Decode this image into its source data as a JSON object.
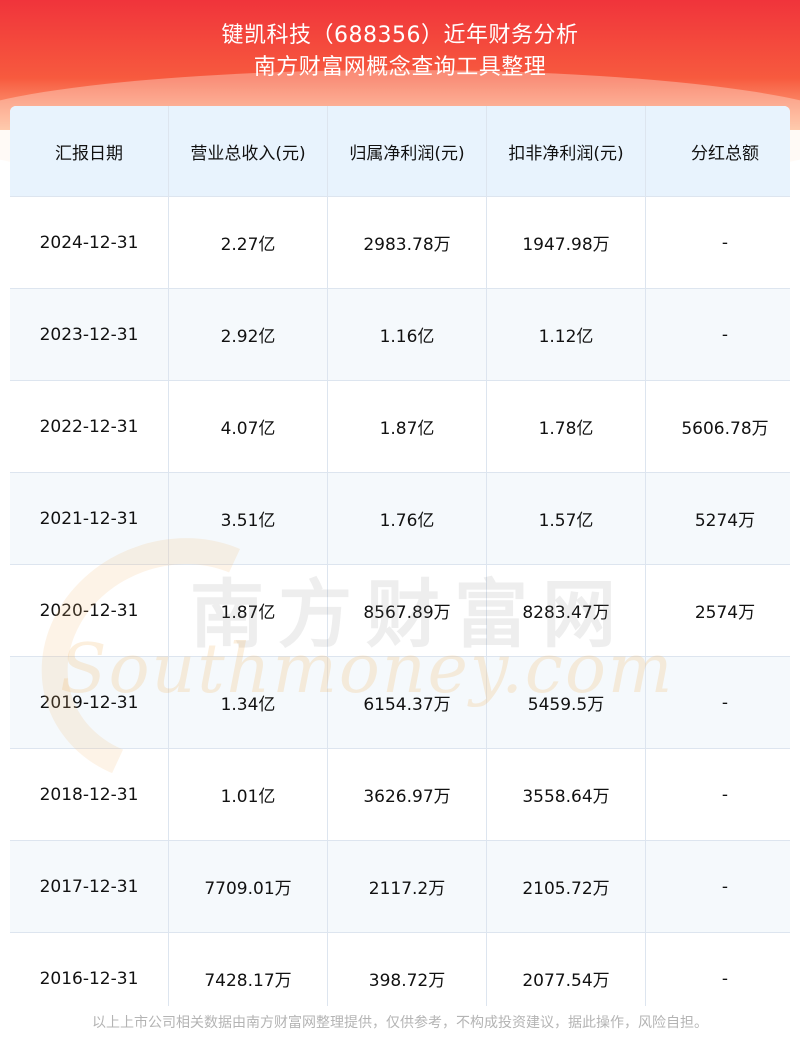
{
  "header": {
    "title_line1": "键凯科技（688356）近年财务分析",
    "title_line2": "南方财富网概念查询工具整理"
  },
  "table": {
    "columns": [
      "汇报日期",
      "营业总收入(元)",
      "归属净利润(元)",
      "扣非净利润(元)",
      "分红总额"
    ],
    "rows": [
      [
        "2024-12-31",
        "2.27亿",
        "2983.78万",
        "1947.98万",
        "-"
      ],
      [
        "2023-12-31",
        "2.92亿",
        "1.16亿",
        "1.12亿",
        "-"
      ],
      [
        "2022-12-31",
        "4.07亿",
        "1.87亿",
        "1.78亿",
        "5606.78万"
      ],
      [
        "2021-12-31",
        "3.51亿",
        "1.76亿",
        "1.57亿",
        "5274万"
      ],
      [
        "2020-12-31",
        "1.87亿",
        "8567.89万",
        "8283.47万",
        "2574万"
      ],
      [
        "2019-12-31",
        "1.34亿",
        "6154.37万",
        "5459.5万",
        "-"
      ],
      [
        "2018-12-31",
        "1.01亿",
        "3626.97万",
        "3558.64万",
        "-"
      ],
      [
        "2017-12-31",
        "7709.01万",
        "2117.2万",
        "2105.72万",
        "-"
      ],
      [
        "2016-12-31",
        "7428.17万",
        "398.72万",
        "2077.54万",
        "-"
      ]
    ]
  },
  "watermark": {
    "cn": "南方财富网",
    "en": "Southmoney.com"
  },
  "footer": {
    "disclaimer": "以上上市公司相关数据由南方财富网整理提供，仅供参考，不构成投资建议，据此操作，风险自担。"
  },
  "colors": {
    "header_red": "#f0343b",
    "header_light": "#ffb68f",
    "table_head_bg": "#e8f3fd",
    "border": "#dde5ef"
  }
}
